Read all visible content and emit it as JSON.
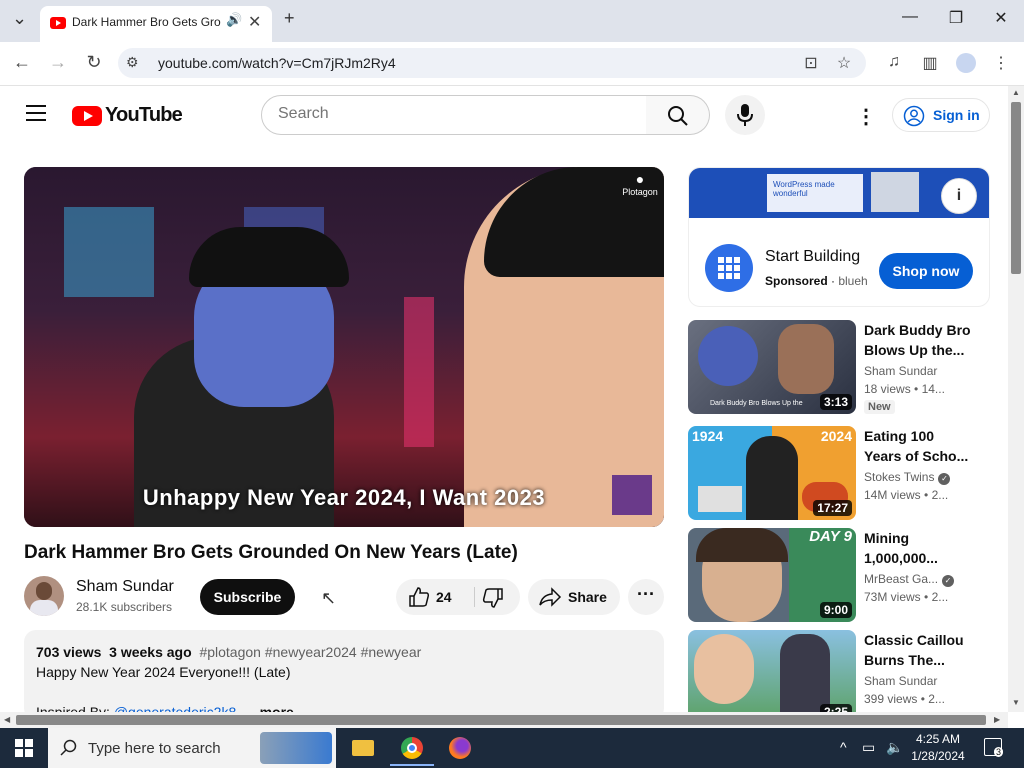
{
  "browser": {
    "tab_title": "Dark Hammer Bro Gets Gro",
    "new_tab": "+",
    "url": "youtube.com/watch?v=Cm7jRJm2Ry4"
  },
  "youtube": {
    "logo_text": "YouTube",
    "search_placeholder": "Search",
    "sign_in": "Sign in"
  },
  "player": {
    "caption": "Unhappy New Year 2024, I Want 2023",
    "watermark": "Plotagon"
  },
  "video": {
    "title": "Dark Hammer Bro Gets Grounded On New Years (Late)",
    "channel": "Sham Sundar",
    "subscribers": "28.1K subscribers",
    "subscribe_label": "Subscribe",
    "likes": "24",
    "share_label": "Share",
    "views": "703 views",
    "age": "3 weeks ago",
    "tags": "#plotagon #newyear2024 #newyear",
    "desc_line1": "Happy New Year 2024 Everyone!!! (Late)",
    "desc_line2_prefix": "Inspired By: ",
    "desc_link": "@generatederic2k8",
    "desc_more": "...more"
  },
  "ad": {
    "banner_text": "WordPress made wonderful",
    "headline": "Start Building",
    "sponsored": "Sponsored",
    "advertiser": "blueh",
    "cta": "Shop now"
  },
  "recommendations": [
    {
      "title": "Dark Buddy Bro Blows Up the...",
      "channel": "Sham Sundar",
      "views": "18 views",
      "age": "14...",
      "duration": "3:13",
      "badge": "New",
      "thumb_text": "Dark Buddy Bro Blows Up the",
      "verified": false
    },
    {
      "title": "Eating 100 Years of Scho...",
      "channel": "Stokes Twins",
      "views": "14M views",
      "age": "2...",
      "duration": "17:27",
      "thumb_left": "1924",
      "thumb_right": "2024",
      "verified": true
    },
    {
      "title": "Mining 1,000,000...",
      "channel": "MrBeast Ga...",
      "views": "73M views",
      "age": "2...",
      "duration": "9:00",
      "thumb_text": "DAY 9",
      "verified": true
    },
    {
      "title": "Classic Caillou Burns The...",
      "channel": "Sham Sundar",
      "views": "399 views",
      "age": "2...",
      "duration": "2:25",
      "verified": false
    }
  ],
  "taskbar": {
    "search_placeholder": "Type here to search",
    "time": "4:25 AM",
    "date": "1/28/2024",
    "notifications": "3"
  },
  "colors": {
    "yt_red": "#ff0000",
    "link_blue": "#065fd4",
    "chip_gray": "#f2f2f2",
    "taskbar": "#1c2a3c"
  }
}
